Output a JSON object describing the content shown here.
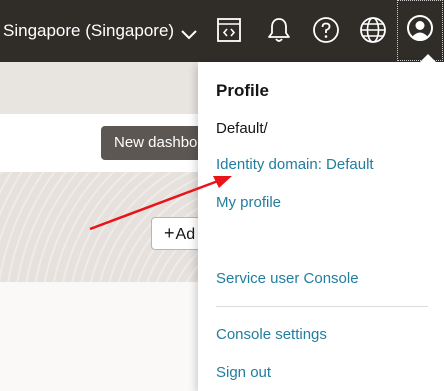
{
  "topbar": {
    "region_label": "Singapore (Singapore)",
    "icons": [
      "chevron-down-icon",
      "code-editor-icon",
      "bell-icon",
      "help-icon",
      "globe-icon",
      "user-profile-icon"
    ]
  },
  "background": {
    "new_dashboard_label": "New dashbo",
    "add_label": "Ad"
  },
  "profile_menu": {
    "title": "Profile",
    "tenancy": "Default/",
    "identity_domain": "Identity domain: Default",
    "my_profile": "My profile",
    "service_user_console": "Service user Console",
    "console_settings": "Console settings",
    "sign_out": "Sign out"
  },
  "colors": {
    "topbar_bg": "#302c28",
    "link": "#227e9e",
    "annotation_arrow": "#e8141a"
  }
}
